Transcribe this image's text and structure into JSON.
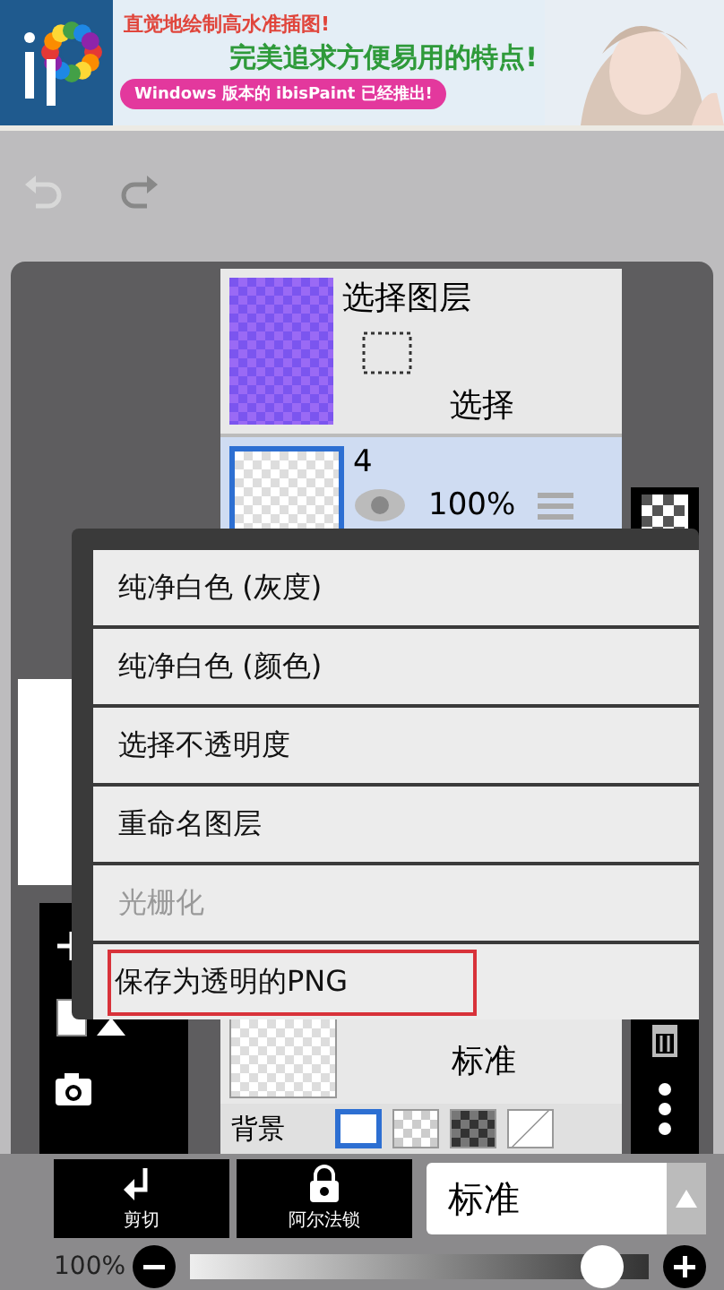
{
  "banner": {
    "headline_1": "直觉地绘制高水准插图!",
    "headline_2": "完美追求方便易用的特点!",
    "button_text": "Windows 版本的 ibisPaint 已经推出!"
  },
  "layers_panel": {
    "select_layer": {
      "title": "选择图层",
      "action": "选择"
    },
    "layers": [
      {
        "name": "4",
        "opacity": "100%",
        "selected": true
      },
      {
        "blend": "标准",
        "selected": false
      }
    ],
    "background": {
      "label": "背景",
      "options": [
        {
          "kind": "white",
          "selected": true
        },
        {
          "kind": "checker",
          "selected": false
        },
        {
          "kind": "dark",
          "selected": false
        },
        {
          "kind": "none",
          "selected": false
        }
      ]
    }
  },
  "context_menu": {
    "items": [
      {
        "label": "纯净白色 (灰度)",
        "disabled": false,
        "marked": false
      },
      {
        "label": "纯净白色 (颜色)",
        "disabled": false,
        "marked": false
      },
      {
        "label": "选择不透明度",
        "disabled": false,
        "marked": false
      },
      {
        "label": "重命名图层",
        "disabled": false,
        "marked": false
      },
      {
        "label": "光栅化",
        "disabled": true,
        "marked": false
      },
      {
        "label": "保存为透明的PNG",
        "disabled": false,
        "marked": true
      }
    ]
  },
  "bottom_bar": {
    "buttons": [
      {
        "kind": "cut",
        "label": "剪切"
      },
      {
        "kind": "lock",
        "label": "阿尔法锁"
      }
    ],
    "blend_mode": {
      "value": "标准"
    }
  },
  "opacity": {
    "reading": "100%",
    "level": 0.94
  }
}
